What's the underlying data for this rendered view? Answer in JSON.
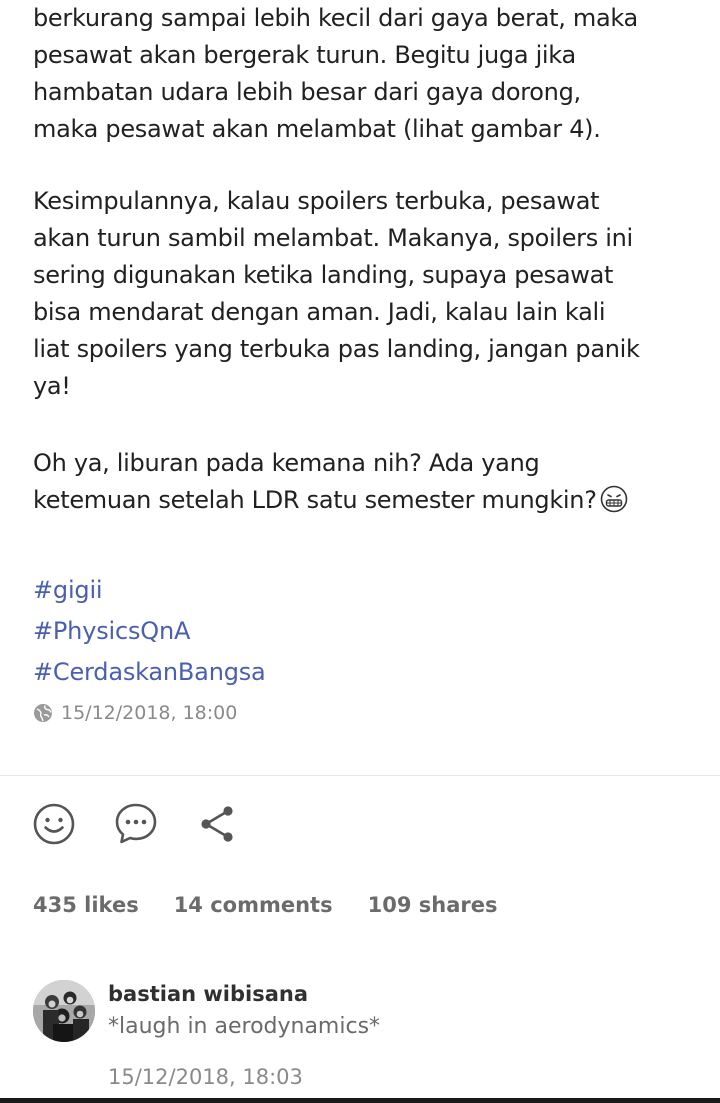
{
  "post": {
    "paragraph1": "berkurang sampai lebih kecil dari gaya berat, maka\npesawat akan bergerak turun. Begitu juga jika\nhambatan udara lebih besar dari gaya dorong,\nmaka pesawat akan melambat (lihat gambar 4).",
    "paragraph2": "Kesimpulannya, kalau spoilers terbuka, pesawat\nakan turun sambil melambat. Makanya, spoilers ini\nsering digunakan ketika landing, supaya pesawat\nbisa mendarat dengan aman. Jadi, kalau lain kali\nliat spoilers yang terbuka pas landing, jangan panik\nya!",
    "paragraph3": "Oh ya, liburan pada kemana nih? Ada yang\nketemuan setelah LDR satu semester mungkin?",
    "emoji_icon": "grimacing-face-icon",
    "hashtags": [
      "#gigii",
      "#PhysicsQnA",
      "#CerdaskanBangsa"
    ],
    "timestamp": "15/12/2018, 18:00",
    "timestamp_icon": "globe-icon",
    "hashtag_color": "#4a5fb0"
  },
  "actions": {
    "react_icon": "smiley-icon",
    "comment_icon": "comment-bubble-icon",
    "share_icon": "share-icon"
  },
  "stats": {
    "likes": "435 likes",
    "comments": "14 comments",
    "shares": "109 shares"
  },
  "comment": {
    "author": "bastian wibisana",
    "text": "*laugh in aerodynamics*",
    "time": "15/12/2018, 18:03"
  }
}
